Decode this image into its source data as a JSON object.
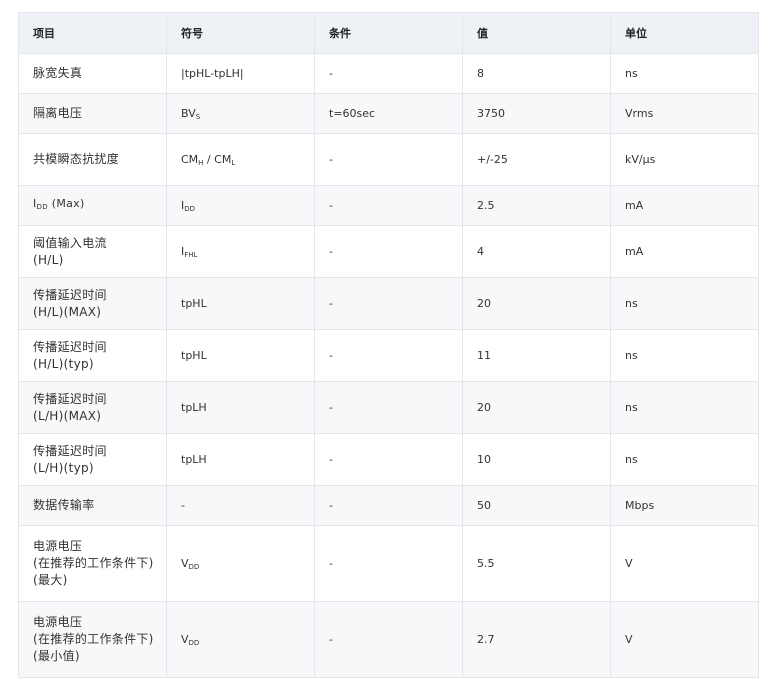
{
  "table": {
    "headers": [
      "项目",
      "符号",
      "条件",
      "值",
      "单位"
    ],
    "rows": [
      {
        "item": [
          "脉宽失真"
        ],
        "symbol": {
          "base": "|tpHL-tpLH|"
        },
        "condition": "-",
        "value": "8",
        "unit": "ns"
      },
      {
        "item": [
          "隔离电压"
        ],
        "symbol": {
          "base": "BV",
          "sub": "S"
        },
        "condition": "t=60sec",
        "value": "3750",
        "unit": "Vrms"
      },
      {
        "item": [
          "共模瞬态抗扰度"
        ],
        "symbol": {
          "base": "CM",
          "sub": "H",
          "mid": " / CM",
          "sub2": "L"
        },
        "condition": "-",
        "value": "+/-25",
        "unit": "kV/μs"
      },
      {
        "item": [
          "I_DD (Max)"
        ],
        "item_rich": {
          "base": "I",
          "sub": "DD",
          "tail": " (Max)"
        },
        "symbol": {
          "base": "I",
          "sub": "DD"
        },
        "condition": "-",
        "value": "2.5",
        "unit": "mA"
      },
      {
        "item": [
          "阈值输入电流",
          "(H/L)"
        ],
        "symbol": {
          "base": "I",
          "sub": "FHL"
        },
        "condition": "-",
        "value": "4",
        "unit": "mA"
      },
      {
        "item": [
          "传播延迟时间",
          "(H/L)(MAX)"
        ],
        "symbol": {
          "base": "tpHL"
        },
        "condition": "-",
        "value": "20",
        "unit": "ns"
      },
      {
        "item": [
          "传播延迟时间",
          "(H/L)(typ)"
        ],
        "symbol": {
          "base": "tpHL"
        },
        "condition": "-",
        "value": "11",
        "unit": "ns"
      },
      {
        "item": [
          "传播延迟时间",
          "(L/H)(MAX)"
        ],
        "symbol": {
          "base": "tpLH"
        },
        "condition": "-",
        "value": "20",
        "unit": "ns"
      },
      {
        "item": [
          "传播延迟时间",
          "(L/H)(typ)"
        ],
        "symbol": {
          "base": "tpLH"
        },
        "condition": "-",
        "value": "10",
        "unit": "ns"
      },
      {
        "item": [
          "数据传输率"
        ],
        "symbol": {
          "base": "-"
        },
        "condition": "-",
        "value": "50",
        "unit": "Mbps"
      },
      {
        "item": [
          "电源电压",
          "(在推荐的工作条件下)",
          "(最大)"
        ],
        "symbol": {
          "base": "V",
          "sub": "DD"
        },
        "condition": "-",
        "value": "5.5",
        "unit": "V"
      },
      {
        "item": [
          "电源电压",
          "(在推荐的工作条件下)",
          "(最小值)"
        ],
        "symbol": {
          "base": "V",
          "sub": "DD"
        },
        "condition": "-",
        "value": "2.7",
        "unit": "V"
      }
    ]
  }
}
